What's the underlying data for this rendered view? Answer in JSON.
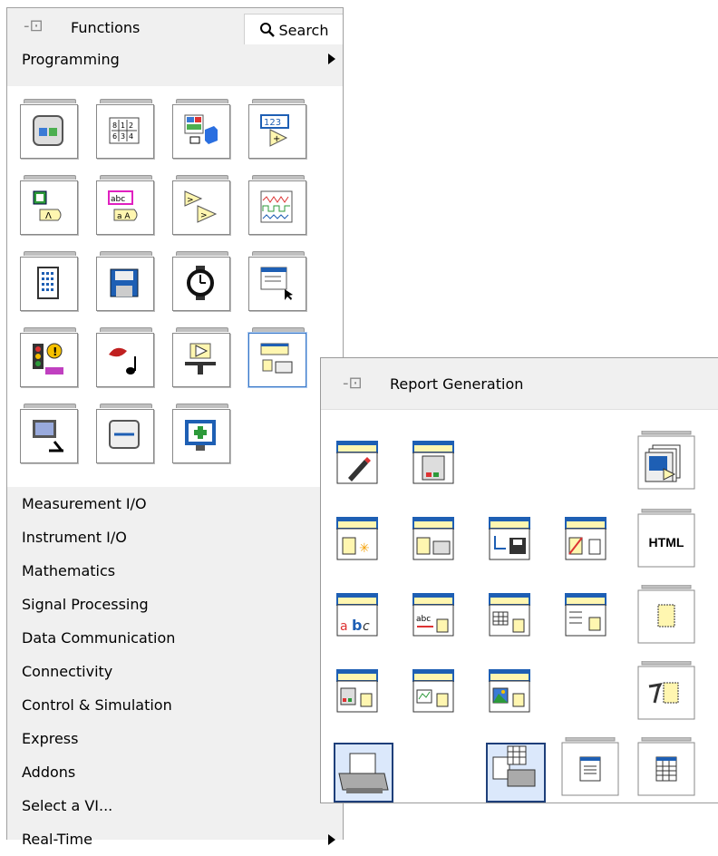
{
  "functions_palette": {
    "title": "Functions",
    "search_label": "Search",
    "current_category": "Programming",
    "categories": [
      "Measurement I/O",
      "Instrument I/O",
      "Mathematics",
      "Signal Processing",
      "Data Communication",
      "Connectivity",
      "Control & Simulation",
      "Express",
      "Addons",
      "Select a VI...",
      "Real-Time"
    ],
    "icons": [
      "structures-icon",
      "array-icon",
      "cluster-icon",
      "numeric-icon",
      "boolean-icon",
      "string-icon",
      "comparison-icon",
      "waveform-icon",
      "timing-icon",
      "file-io-icon",
      "timing-watch-icon",
      "dialog-ui-icon",
      "error-icon",
      "sound-icon",
      "synchronization-icon",
      "report-generation-icon",
      "application-control-icon",
      "graphics-icon",
      "drawing-icon"
    ]
  },
  "report_palette": {
    "title": "Report Generation",
    "html_label": "HTML",
    "accent": "#1e5fb4"
  }
}
